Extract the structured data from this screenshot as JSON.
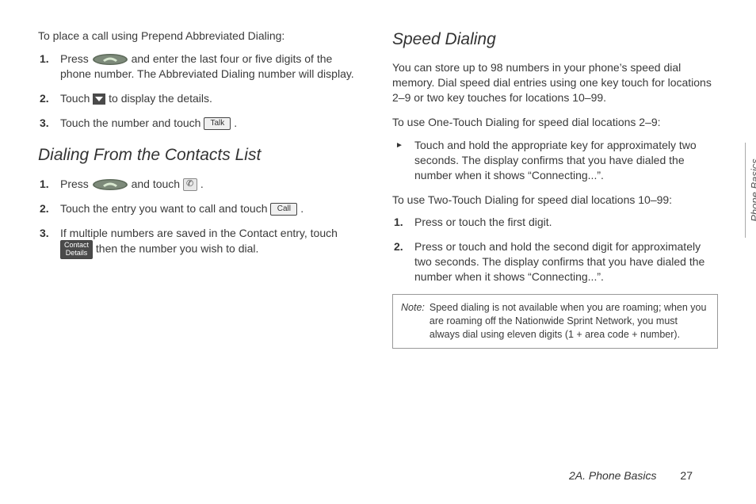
{
  "sideTab": "Phone Basics",
  "footer": {
    "section": "2A. Phone Basics",
    "page": "27"
  },
  "left": {
    "intro1": "To place a call using Prepend Abbreviated Dialing:",
    "list1": {
      "i1a": "Press ",
      "i1b": " and enter the last four or five digits of the phone number. The Abbreviated Dialing number will display.",
      "i2a": "Touch ",
      "i2b": " to display the details.",
      "i3a": "Touch the number and touch ",
      "i3b": "."
    },
    "talkBtn": "Talk",
    "heading1": "Dialing From the Contacts List",
    "list2": {
      "i1a": "Press ",
      "i1b": " and touch ",
      "i1c": ".",
      "i2a": "Touch the entry you want to call and touch ",
      "i2b": ".",
      "i3a": "If multiple numbers are saved in the Contact entry, touch ",
      "i3b": " then the number you wish to dial."
    },
    "callBtn": "Call",
    "contactDetailsBtn": "Contact\nDetails"
  },
  "right": {
    "heading": "Speed Dialing",
    "body1": "You can store up to 98 numbers in your phone’s speed dial memory. Dial speed dial entries using one key touch for locations 2–9 or two key touches for locations 10–99.",
    "intro1": "To use One-Touch Dialing for speed dial locations 2–9:",
    "bullet1": "Touch and hold the appropriate key for approximately two seconds. The display confirms that you have dialed the number when it shows “Connecting...”.",
    "intro2": "To use Two-Touch Dialing for speed dial locations 10–99:",
    "step1": "Press or touch the first digit.",
    "step2": "Press or touch and hold the second digit for approximately two seconds. The display confirms that you have dialed the number when it shows “Connecting...”.",
    "noteLabel": "Note:",
    "noteBody": "Speed dialing is not available when you are roaming; when you are roaming off the Nationwide Sprint Network, you must always dial using eleven digits (1 + area code + number)."
  }
}
